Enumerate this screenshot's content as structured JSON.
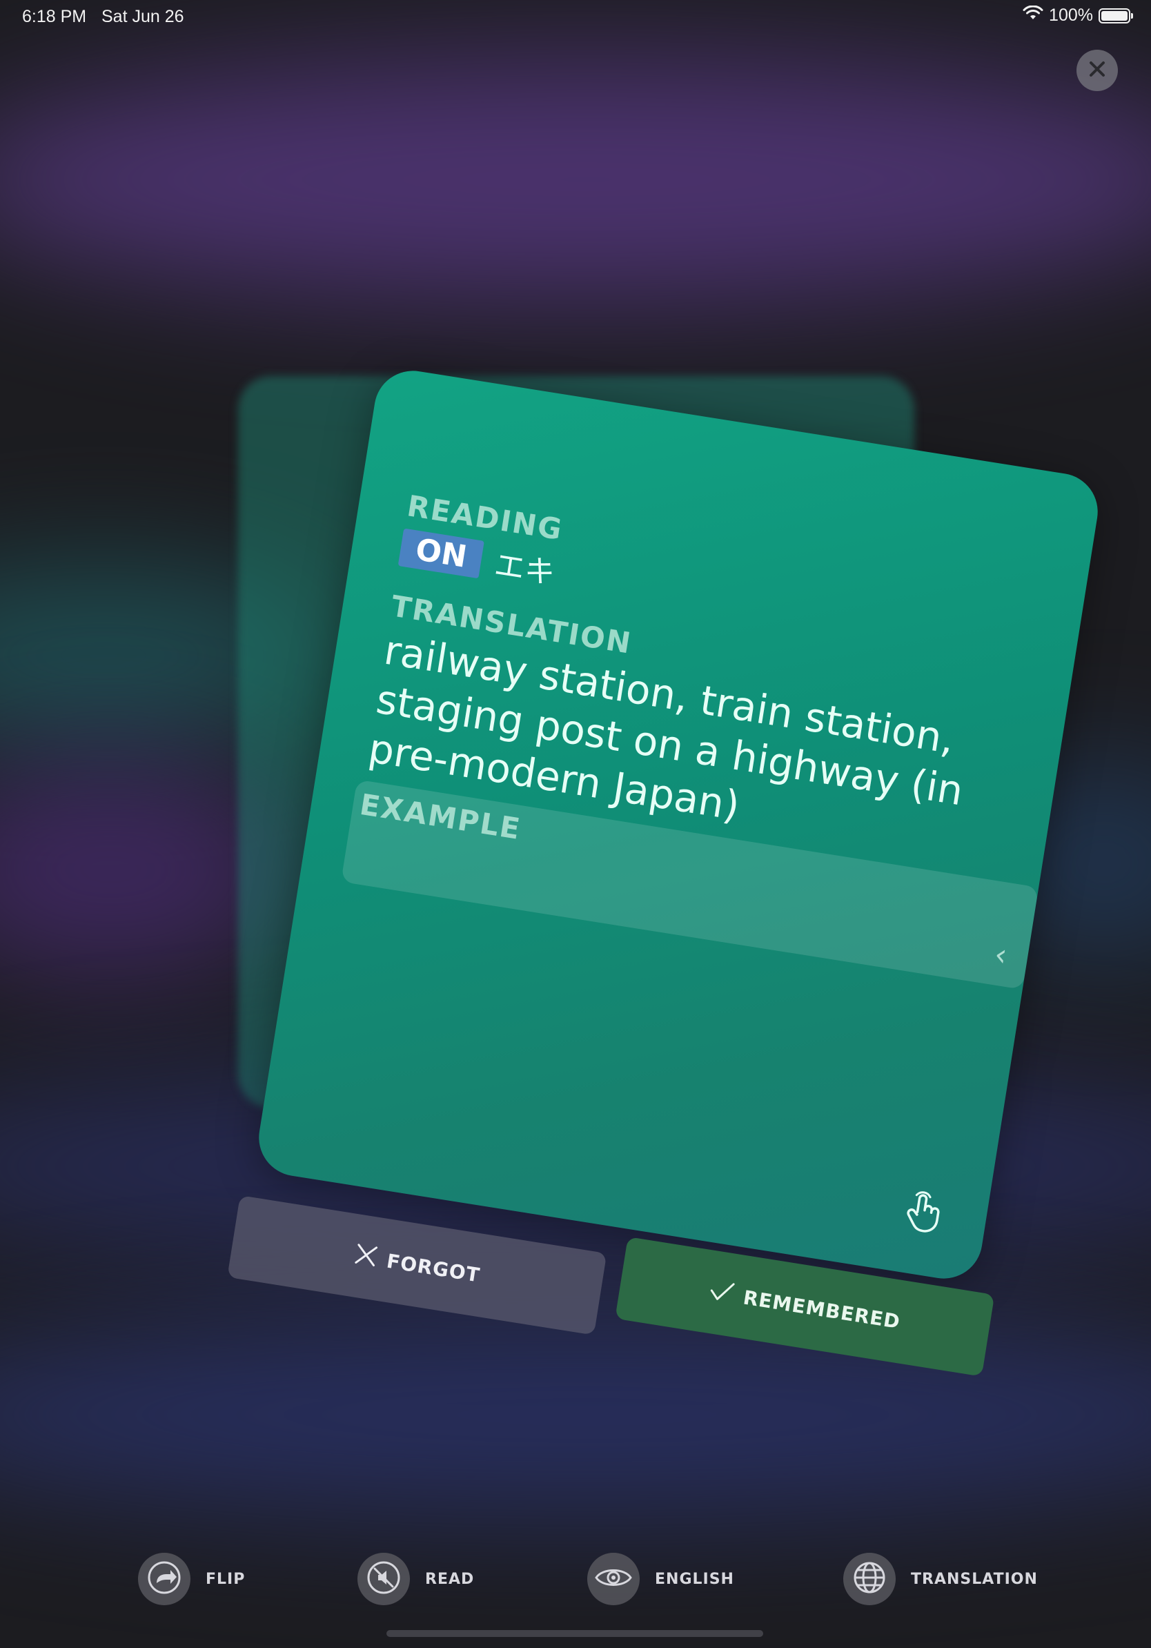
{
  "status_bar": {
    "time": "6:18 PM",
    "date": "Sat Jun 26",
    "battery": "100%"
  },
  "card": {
    "reading_label": "READING",
    "reading_badge": "ON",
    "reading_value": "エキ",
    "translation_label": "TRANSLATION",
    "translation_text": "railway station, train station, staging post on a highway (in pre-modern Japan)",
    "example_label": "EXAMPLE",
    "example_chevron": "‹"
  },
  "buttons": {
    "forgot_label": "FORGOT",
    "remembered_label": "REMEMBERED"
  },
  "toolbar": {
    "flip_label": "FLIP",
    "read_label": "READ",
    "english_label": "ENGLISH",
    "translation_label": "TRANSLATION"
  },
  "icons": {
    "close": "close-icon",
    "wifi": "wifi-icon",
    "battery": "battery-icon",
    "tap": "tap-hand-icon",
    "forgot": "x-icon",
    "remembered": "check-icon",
    "flip": "share-arrow-icon",
    "read": "speaker-muted-icon",
    "english": "eye-icon",
    "translation": "globe-icon"
  },
  "colors": {
    "card": "#12a384",
    "on_badge": "#4a82c2",
    "forgot_button": "#5a5a6e",
    "remembered_button": "#2c6a45"
  }
}
